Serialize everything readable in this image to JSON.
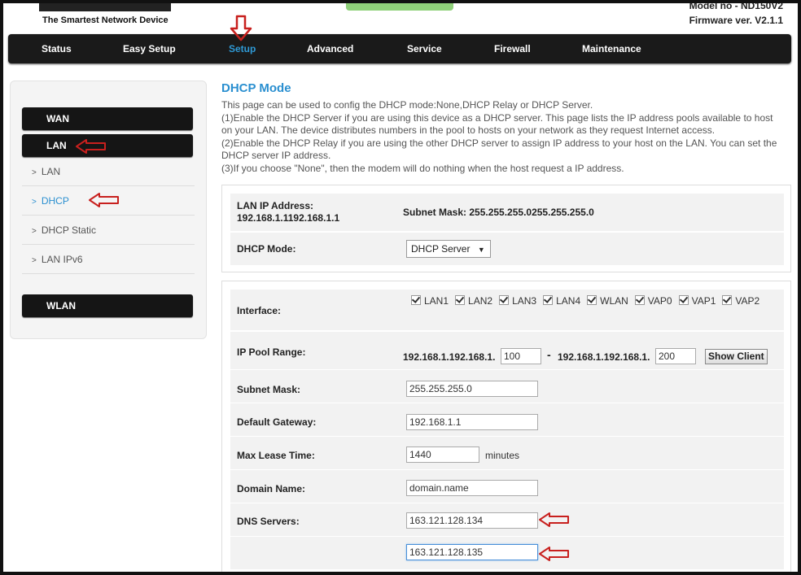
{
  "header": {
    "brand_tagline": "The Smartest Network Device",
    "model_no": "Model no - ND150V2",
    "firmware": "Firmware ver. V2.1.1"
  },
  "nav": {
    "items": [
      {
        "label": "Status"
      },
      {
        "label": "Easy Setup"
      },
      {
        "label": "Setup",
        "active": true
      },
      {
        "label": "Advanced"
      },
      {
        "label": "Service"
      },
      {
        "label": "Firewall"
      },
      {
        "label": "Maintenance"
      }
    ]
  },
  "sidebar": {
    "wan": "WAN",
    "lan": "LAN",
    "links": [
      {
        "label": "LAN"
      },
      {
        "label": "DHCP",
        "current": true
      },
      {
        "label": "DHCP Static"
      },
      {
        "label": "LAN IPv6"
      }
    ],
    "wlan": "WLAN",
    "link_marker": ">"
  },
  "main": {
    "title": "DHCP Mode",
    "description": [
      "This page can be used to config the DHCP mode:None,DHCP Relay or DHCP Server.",
      "(1)Enable the DHCP Server if you are using this device as a DHCP server. This page lists the IP address pools available to host",
      "on your LAN. The device distributes numbers in the pool to hosts on your network as they request Internet access.",
      "(2)Enable the DHCP Relay if you are using the other DHCP server to assign IP address to your host on the LAN. You can set the",
      "DHCP server IP address.",
      "(3)If you choose \"None\", then the modem will do nothing when the host request a IP address."
    ],
    "lan_ip_label": "LAN IP Address:",
    "lan_ip_value": "192.168.1.1192.168.1.1",
    "subnet_mask_text": "Subnet Mask: 255.255.255.0255.255.255.0",
    "dhcp_mode_label": "DHCP Mode:",
    "dhcp_mode_value": "DHCP Server",
    "dhcp_mode_caret": "▼",
    "interface_label": "Interface:",
    "interfaces": [
      "LAN1",
      "LAN2",
      "LAN3",
      "LAN4",
      "WLAN",
      "VAP0",
      "VAP1",
      "VAP2"
    ],
    "ip_pool_label": "IP Pool Range:",
    "ip_pool_prefix_start": "192.168.1.192.168.1.",
    "ip_pool_start": "100",
    "ip_pool_sep": "-",
    "ip_pool_prefix_end": "192.168.1.192.168.1.",
    "ip_pool_end": "200",
    "show_client": "Show Client",
    "subnet_label": "Subnet Mask:",
    "subnet_value": "255.255.255.0",
    "gateway_label": "Default Gateway:",
    "gateway_value": "192.168.1.1",
    "lease_label": "Max Lease Time:",
    "lease_value": "1440",
    "lease_unit": "minutes",
    "domain_label": "Domain Name:",
    "domain_value": "domain.name",
    "dns_label": "DNS Servers:",
    "dns1": "163.121.128.134",
    "dns2": "163.121.128.135"
  },
  "colors": {
    "accent": "#2a8fd0",
    "annotation_arrow": "#c8201e",
    "navbar": "#1a1a1a"
  }
}
